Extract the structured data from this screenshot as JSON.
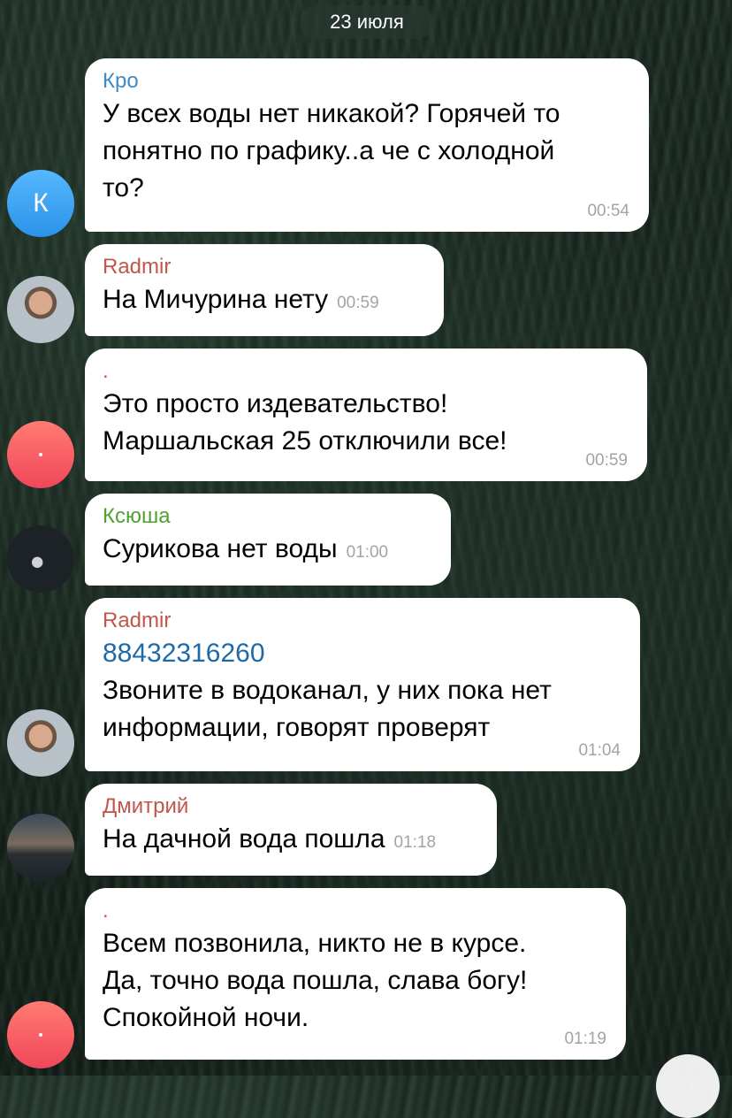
{
  "date_separator": "23 июля",
  "colors": {
    "bubble": "#ffffff",
    "time": "#a0a4a8",
    "link": "#1e6aa8",
    "sender_kro": "#3f8bc8",
    "sender_radmir": "#c1564a",
    "sender_dot": "#d94a4a",
    "sender_ksyusha": "#4ea32e",
    "sender_dmitry": "#c1564a"
  },
  "messages": [
    {
      "sender": "Кро",
      "text": "У всех воды нет никакой? Горячей то\nпонятно по графику..а че с холодной\nто?",
      "time": "00:54",
      "avatar_letter": "К"
    },
    {
      "sender": "Radmir",
      "text": "На Мичурина нету",
      "time": "00:59"
    },
    {
      "sender": ".",
      "text": "Это просто издевательство!\nМаршальская 25 отключили все!",
      "time": "00:59"
    },
    {
      "sender": "Ксюша",
      "text": "Сурикова нет воды",
      "time": "01:00"
    },
    {
      "sender": "Radmir",
      "phone": "88432316260",
      "text": "Звоните в водоканал, у них пока нет\nинформации, говорят проверят",
      "time": "01:04"
    },
    {
      "sender": "Дмитрий",
      "text": "На дачной вода пошла",
      "time": "01:18"
    },
    {
      "sender": ".",
      "text": "Всем позвонила, никто не в курсе.\nДа, точно вода пошла, слава богу!\nСпокойной ночи.",
      "time": "01:19"
    }
  ]
}
